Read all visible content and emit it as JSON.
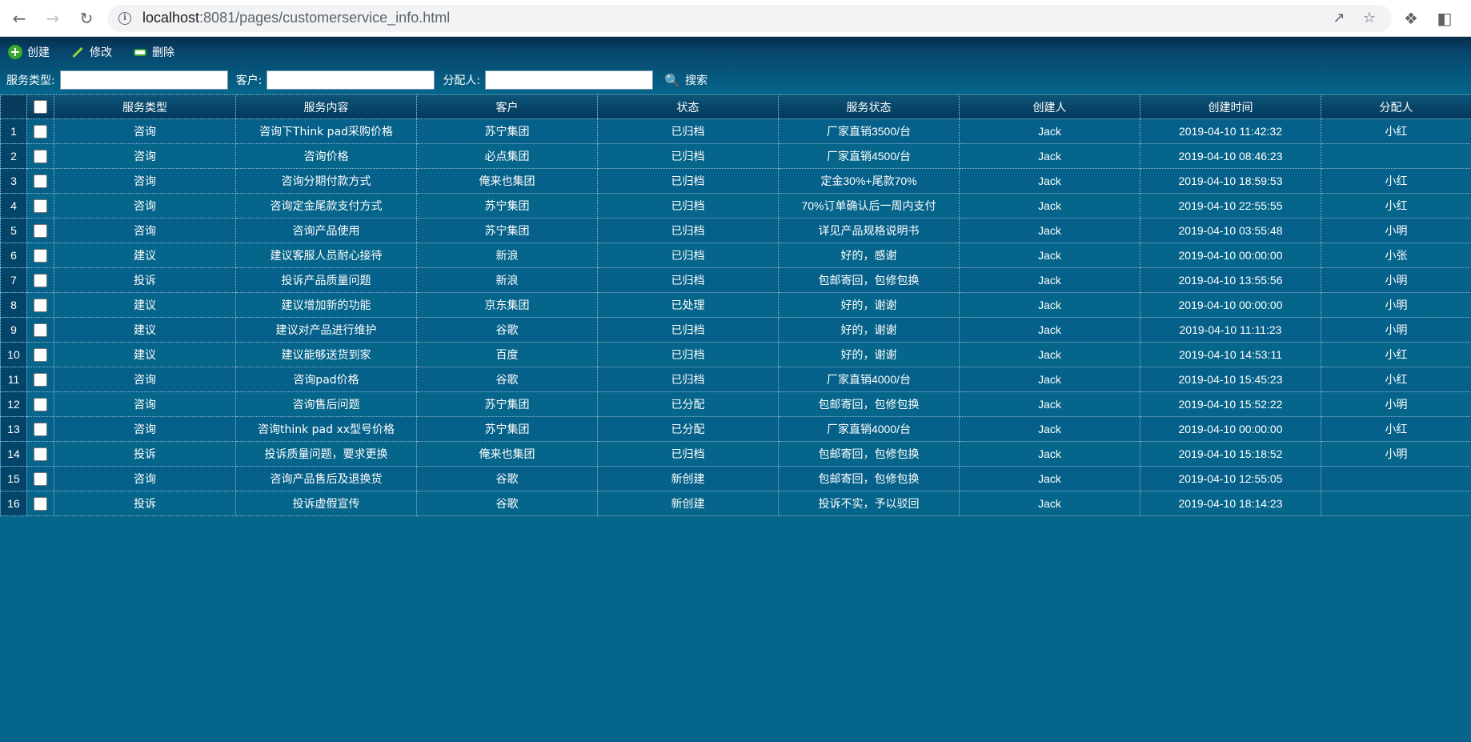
{
  "browser": {
    "url_host": "localhost",
    "url_rest": ":8081/pages/customerservice_info.html"
  },
  "toolbar": {
    "create_label": "创建",
    "edit_label": "修改",
    "delete_label": "删除"
  },
  "search": {
    "service_type_label": "服务类型:",
    "customer_label": "客户:",
    "assignee_label": "分配人:",
    "search_label": "搜索",
    "service_type_value": "",
    "customer_value": "",
    "assignee_value": ""
  },
  "table": {
    "headers": [
      "服务类型",
      "服务内容",
      "客户",
      "状态",
      "服务状态",
      "创建人",
      "创建时间",
      "分配人"
    ],
    "rows": [
      [
        "1",
        "咨询",
        "咨询下Think pad采购价格",
        "苏宁集团",
        "已归档",
        "厂家直销3500/台",
        "Jack",
        "2019-04-10 11:42:32",
        "小红"
      ],
      [
        "2",
        "咨询",
        "咨询价格",
        "必点集团",
        "已归档",
        "厂家直销4500/台",
        "Jack",
        "2019-04-10 08:46:23",
        ""
      ],
      [
        "3",
        "咨询",
        "咨询分期付款方式",
        "俺来也集团",
        "已归档",
        "定金30%+尾款70%",
        "Jack",
        "2019-04-10 18:59:53",
        "小红"
      ],
      [
        "4",
        "咨询",
        "咨询定金尾款支付方式",
        "苏宁集团",
        "已归档",
        "70%订单确认后一周内支付",
        "Jack",
        "2019-04-10 22:55:55",
        "小红"
      ],
      [
        "5",
        "咨询",
        "咨询产品使用",
        "苏宁集团",
        "已归档",
        "详见产品规格说明书",
        "Jack",
        "2019-04-10 03:55:48",
        "小明"
      ],
      [
        "6",
        "建议",
        "建议客服人员耐心接待",
        "新浪",
        "已归档",
        "好的，感谢",
        "Jack",
        "2019-04-10 00:00:00",
        "小张"
      ],
      [
        "7",
        "投诉",
        "投诉产品质量问题",
        "新浪",
        "已归档",
        "包邮寄回，包修包换",
        "Jack",
        "2019-04-10 13:55:56",
        "小明"
      ],
      [
        "8",
        "建议",
        "建议增加新的功能",
        "京东集团",
        "已处理",
        "好的，谢谢",
        "Jack",
        "2019-04-10 00:00:00",
        "小明"
      ],
      [
        "9",
        "建议",
        "建议对产品进行维护",
        "谷歌",
        "已归档",
        "好的，谢谢",
        "Jack",
        "2019-04-10 11:11:23",
        "小明"
      ],
      [
        "10",
        "建议",
        "建议能够送货到家",
        "百度",
        "已归档",
        "好的，谢谢",
        "Jack",
        "2019-04-10 14:53:11",
        "小红"
      ],
      [
        "11",
        "咨询",
        "咨询pad价格",
        "谷歌",
        "已归档",
        "厂家直销4000/台",
        "Jack",
        "2019-04-10 15:45:23",
        "小红"
      ],
      [
        "12",
        "咨询",
        "咨询售后问题",
        "苏宁集团",
        "已分配",
        "包邮寄回，包修包换",
        "Jack",
        "2019-04-10 15:52:22",
        "小明"
      ],
      [
        "13",
        "咨询",
        "咨询think pad xx型号价格",
        "苏宁集团",
        "已分配",
        "厂家直销4000/台",
        "Jack",
        "2019-04-10 00:00:00",
        "小红"
      ],
      [
        "14",
        "投诉",
        "投诉质量问题，要求更换",
        "俺来也集团",
        "已归档",
        "包邮寄回，包修包换",
        "Jack",
        "2019-04-10 15:18:52",
        "小明"
      ],
      [
        "15",
        "咨询",
        "咨询产品售后及退换货",
        "谷歌",
        "新创建",
        "包邮寄回，包修包换",
        "Jack",
        "2019-04-10 12:55:05",
        ""
      ],
      [
        "16",
        "投诉",
        "投诉虚假宣传",
        "谷歌",
        "新创建",
        "投诉不实，予以驳回",
        "Jack",
        "2019-04-10 18:14:23",
        ""
      ]
    ]
  },
  "icons": {
    "back": "arrow-left-icon",
    "forward": "arrow-right-icon",
    "reload": "reload-icon",
    "create": "plus-icon",
    "edit": "pencil-icon",
    "delete": "minus-icon",
    "search": "magnifier-icon"
  },
  "colors": {
    "page_bg": "#05658a",
    "header_bg": "#04385b",
    "create_green": "#3aa62d"
  }
}
